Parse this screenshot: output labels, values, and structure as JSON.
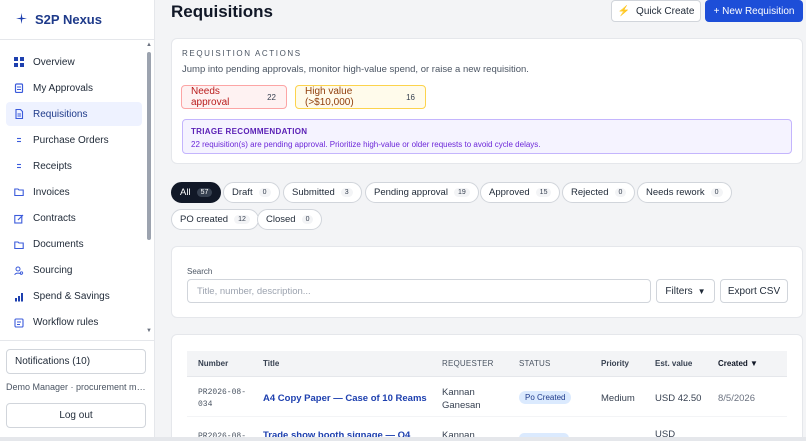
{
  "brand": {
    "name": "S2P Nexus",
    "logo_icon": "sparkle-icon"
  },
  "sidebar": {
    "items": [
      {
        "label": "Overview",
        "icon": "grid-icon",
        "active": false
      },
      {
        "label": "My Approvals",
        "icon": "clipboard-icon",
        "active": false
      },
      {
        "label": "Requisitions",
        "icon": "document-icon",
        "active": true
      },
      {
        "label": "Purchase Orders",
        "icon": "list-icon",
        "active": false
      },
      {
        "label": "Receipts",
        "icon": "list-icon",
        "active": false
      },
      {
        "label": "Invoices",
        "icon": "folder-icon",
        "active": false
      },
      {
        "label": "Contracts",
        "icon": "edit-icon",
        "active": false
      },
      {
        "label": "Documents",
        "icon": "folder-icon",
        "active": false
      },
      {
        "label": "Sourcing",
        "icon": "people-icon",
        "active": false
      },
      {
        "label": "Spend & Savings",
        "icon": "bar-chart-icon",
        "active": false
      },
      {
        "label": "Workflow rules",
        "icon": "workflow-icon",
        "active": false
      }
    ],
    "notifications_label": "Notifications (10)",
    "user_line": "Demo Manager · procurement manager",
    "logout_label": "Log out"
  },
  "header": {
    "title": "Requisitions",
    "quick_create_label": "Quick Create",
    "new_label": "+ New Requisition"
  },
  "actions": {
    "eyebrow": "REQUISITION ACTIONS",
    "subtitle": "Jump into pending approvals, monitor high-value spend, or raise a new requisition.",
    "needs_approval": {
      "label": "Needs approval",
      "count": "22"
    },
    "high_value": {
      "label": "High value (>$10,000)",
      "count": "16"
    },
    "triage_title": "TRIAGE RECOMMENDATION",
    "triage_text": "22 requisition(s) are pending approval. Prioritize high-value or older requests to avoid cycle delays."
  },
  "tabs": [
    {
      "label": "All",
      "count": "57",
      "active": true
    },
    {
      "label": "Draft",
      "count": "0"
    },
    {
      "label": "Submitted",
      "count": "3"
    },
    {
      "label": "Pending approval",
      "count": "19"
    },
    {
      "label": "Approved",
      "count": "15"
    },
    {
      "label": "Rejected",
      "count": "0"
    },
    {
      "label": "Needs rework",
      "count": "0"
    },
    {
      "label": "PO created",
      "count": "12"
    },
    {
      "label": "Closed",
      "count": "0"
    }
  ],
  "search": {
    "label": "Search",
    "placeholder": "Title, number, description...",
    "filters_label": "Filters",
    "export_label": "Export CSV"
  },
  "table": {
    "headers": {
      "number": "Number",
      "title": "Title",
      "requester": "REQUESTER",
      "status": "STATUS",
      "priority": "Priority",
      "est_value": "Est. value",
      "created": "Created"
    },
    "rows": [
      {
        "number": "PR2026-08-034",
        "number_l1": "PR2026-08-",
        "number_l2": "034",
        "title": "A4 Copy Paper — Case of 10 Reams",
        "requester_l1": "Kannan",
        "requester_l2": "Ganesan",
        "status": "Po Created",
        "priority": "Medium",
        "est_value": "USD 42.50",
        "created": "8/5/2026"
      },
      {
        "number_l1": "PR2026-08-",
        "title": "Trade show booth signage — Q4",
        "requester_l1": "Kannan",
        "est_value": "USD"
      }
    ]
  }
}
